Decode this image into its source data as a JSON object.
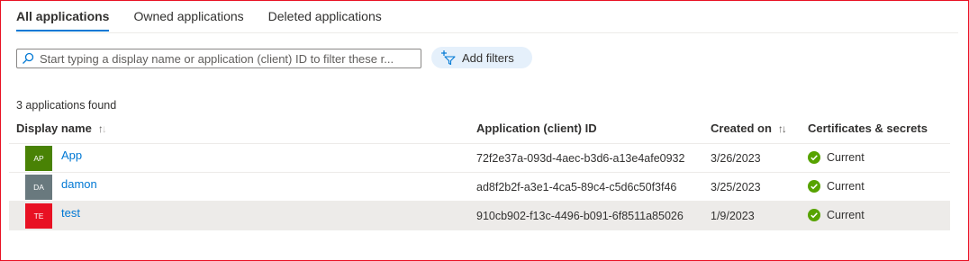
{
  "tabs": [
    {
      "label": "All applications",
      "active": true
    },
    {
      "label": "Owned applications",
      "active": false
    },
    {
      "label": "Deleted applications",
      "active": false
    }
  ],
  "search": {
    "placeholder": "Start typing a display name or application (client) ID to filter these r..."
  },
  "filter_button": {
    "label": "Add filters"
  },
  "result_count": "3 applications found",
  "columns": {
    "display_name": "Display name",
    "client_id": "Application (client) ID",
    "created_on": "Created on",
    "certificates": "Certificates & secrets"
  },
  "rows": [
    {
      "initials": "AP",
      "avatar_color": "#498205",
      "name": "App",
      "client_id": "72f2e37a-093d-4aec-b3d6-a13e4afe0932",
      "created": "3/26/2023",
      "status": "Current"
    },
    {
      "initials": "DA",
      "avatar_color": "#69797e",
      "name": "damon",
      "client_id": "ad8f2b2f-a3e1-4ca5-89c4-c5d6c50f3f46",
      "created": "3/25/2023",
      "status": "Current"
    },
    {
      "initials": "TE",
      "avatar_color": "#e81123",
      "name": "test",
      "client_id": "910cb902-f13c-4496-b091-6f8511a85026",
      "created": "1/9/2023",
      "status": "Current"
    }
  ],
  "colors": {
    "accent": "#0078d4",
    "status_ok": "#57a300",
    "frame_border": "#e81123"
  }
}
